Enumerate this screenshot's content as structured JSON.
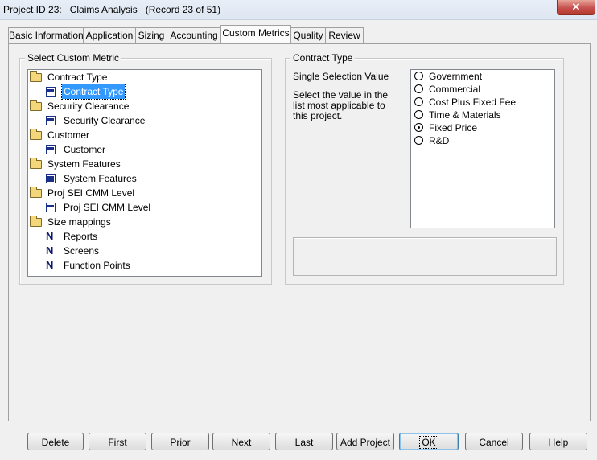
{
  "window": {
    "title": "Project ID 23:   Claims Analysis   (Record 23 of 51)",
    "close_glyph": "✕"
  },
  "tabs": [
    {
      "label": "Basic Information"
    },
    {
      "label": "Application"
    },
    {
      "label": "Sizing"
    },
    {
      "label": "Accounting"
    },
    {
      "label": "Custom Metrics",
      "active": true
    },
    {
      "label": "Quality"
    },
    {
      "label": "Review"
    }
  ],
  "custom_metric_panel": {
    "group_label": "Select Custom Metric",
    "tree": [
      {
        "label": "Contract Type",
        "icon": "folder-icon"
      },
      {
        "label": "Contract Type",
        "icon": "single-select-metric-icon",
        "selected": true
      },
      {
        "label": "Security Clearance",
        "icon": "folder-icon"
      },
      {
        "label": "Security Clearance",
        "icon": "single-select-metric-icon"
      },
      {
        "label": "Customer",
        "icon": "folder-icon"
      },
      {
        "label": "Customer",
        "icon": "single-select-metric-icon"
      },
      {
        "label": "System Features",
        "icon": "folder-icon"
      },
      {
        "label": "System Features",
        "icon": "multi-select-metric-icon"
      },
      {
        "label": "Proj SEI CMM Level",
        "icon": "folder-icon"
      },
      {
        "label": "Proj SEI CMM Level",
        "icon": "single-select-metric-icon"
      },
      {
        "label": "Size mappings",
        "icon": "folder-icon"
      },
      {
        "label": "Reports",
        "icon": "numeric-metric-icon"
      },
      {
        "label": "Screens",
        "icon": "numeric-metric-icon"
      },
      {
        "label": "Function Points",
        "icon": "numeric-metric-icon"
      }
    ]
  },
  "contract_type_panel": {
    "group_label": "Contract Type",
    "selection_mode": "Single Selection Value",
    "instruction": "Select the value in the list most applicable to this project.",
    "options": [
      {
        "label": "Government",
        "checked": false
      },
      {
        "label": "Commercial",
        "checked": false
      },
      {
        "label": "Cost Plus Fixed Fee",
        "checked": false
      },
      {
        "label": "Time & Materials",
        "checked": false
      },
      {
        "label": "Fixed Price",
        "checked": true
      },
      {
        "label": "R&D",
        "checked": false
      }
    ]
  },
  "buttons": {
    "delete": "Delete",
    "first": "First",
    "prior": "Prior",
    "next": "Next",
    "last": "Last",
    "add_project": "Add Project",
    "ok": "OK",
    "cancel": "Cancel",
    "help": "Help"
  }
}
